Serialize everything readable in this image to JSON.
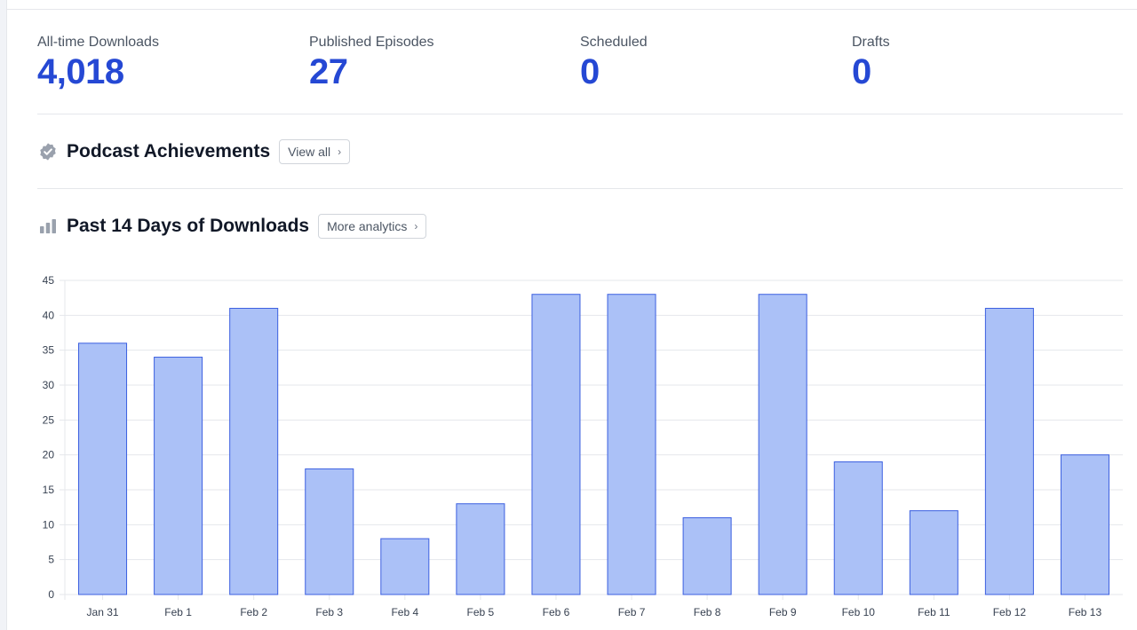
{
  "stats": [
    {
      "label": "All-time Downloads",
      "value": "4,018"
    },
    {
      "label": "Published Episodes",
      "value": "27"
    },
    {
      "label": "Scheduled",
      "value": "0"
    },
    {
      "label": "Drafts",
      "value": "0"
    }
  ],
  "achievements": {
    "title": "Podcast Achievements",
    "button_label": "View all",
    "icon": "verified-badge-icon"
  },
  "downloads": {
    "title": "Past 14 Days of Downloads",
    "button_label": "More analytics",
    "icon": "bar-chart-icon"
  },
  "colors": {
    "accent": "#2548d4",
    "bar_fill": "#abc1f7",
    "bar_stroke": "#3b5fe0"
  },
  "chart_data": {
    "type": "bar",
    "title": "",
    "xlabel": "",
    "ylabel": "",
    "categories": [
      "Jan 31",
      "Feb 1",
      "Feb 2",
      "Feb 3",
      "Feb 4",
      "Feb 5",
      "Feb 6",
      "Feb 7",
      "Feb 8",
      "Feb 9",
      "Feb 10",
      "Feb 11",
      "Feb 12",
      "Feb 13"
    ],
    "values": [
      36,
      34,
      41,
      18,
      8,
      13,
      43,
      43,
      11,
      43,
      19,
      12,
      41,
      20
    ],
    "ylim": [
      0,
      45
    ],
    "yticks": [
      0,
      5,
      10,
      15,
      20,
      25,
      30,
      35,
      40,
      45
    ],
    "grid": true,
    "legend": "none"
  }
}
